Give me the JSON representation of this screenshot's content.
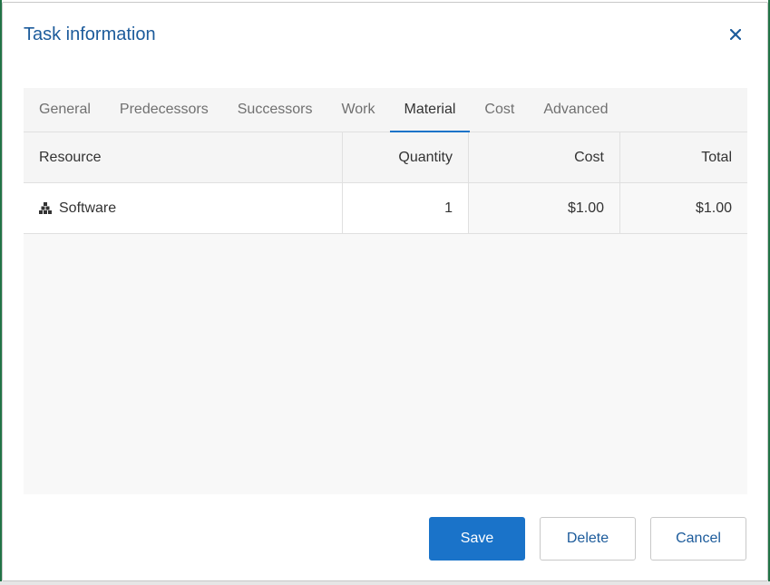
{
  "dialog": {
    "title": "Task information",
    "close_icon": "close-icon"
  },
  "tabs": [
    {
      "label": "General"
    },
    {
      "label": "Predecessors"
    },
    {
      "label": "Successors"
    },
    {
      "label": "Work"
    },
    {
      "label": "Material",
      "active": true
    },
    {
      "label": "Cost"
    },
    {
      "label": "Advanced"
    }
  ],
  "grid": {
    "columns": [
      "Resource",
      "Quantity",
      "Cost",
      "Total"
    ],
    "rows": [
      {
        "resource": "Software",
        "quantity": "1",
        "cost": "$1.00",
        "total": "$1.00",
        "icon": "resource-hierarchy-icon"
      }
    ]
  },
  "buttons": {
    "save": "Save",
    "delete": "Delete",
    "cancel": "Cancel"
  },
  "colors": {
    "accent": "#1a73c9",
    "title": "#1c5b9b"
  }
}
